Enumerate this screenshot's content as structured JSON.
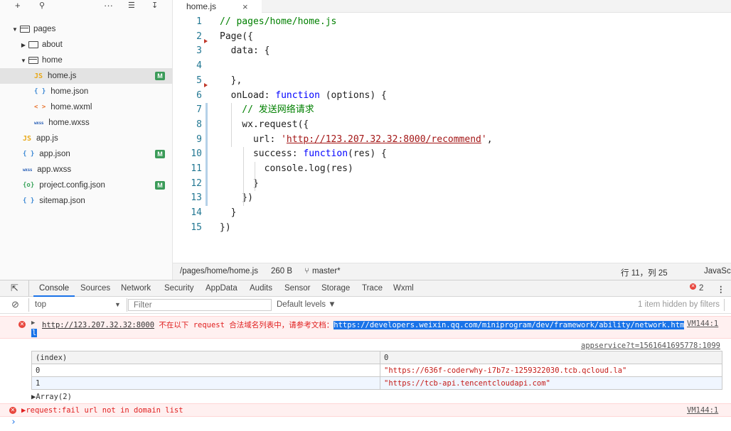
{
  "sidebar": {
    "toolbar": {
      "add": "+",
      "search": "🔍",
      "more": "···",
      "collapse": "☰",
      "split": "⊟"
    },
    "tree": [
      {
        "label": "pages",
        "type": "folder-open",
        "depth": 0
      },
      {
        "label": "about",
        "type": "folder-closed",
        "depth": 1
      },
      {
        "label": "home",
        "type": "folder-open",
        "depth": 1
      },
      {
        "label": "home.js",
        "type": "js",
        "depth": 2,
        "badge": "M",
        "selected": true
      },
      {
        "label": "home.json",
        "type": "json",
        "depth": 2
      },
      {
        "label": "home.wxml",
        "type": "wxml",
        "depth": 2
      },
      {
        "label": "home.wxss",
        "type": "wxss",
        "depth": 2
      },
      {
        "label": "app.js",
        "type": "js",
        "depth": 0
      },
      {
        "label": "app.json",
        "type": "json",
        "depth": 0,
        "badge": "M"
      },
      {
        "label": "app.wxss",
        "type": "wxss",
        "depth": 0
      },
      {
        "label": "project.config.json",
        "type": "cfg",
        "depth": 0,
        "badge": "M"
      },
      {
        "label": "sitemap.json",
        "type": "json",
        "depth": 0
      }
    ],
    "icons": {
      "js": "JS",
      "json": "{ }",
      "wxml": "< >",
      "wxss": "wxss",
      "cfg": "{o}"
    }
  },
  "editor": {
    "tab": {
      "label": "home.js",
      "close": "×"
    },
    "lines": [
      {
        "n": "1",
        "tokens": [
          [
            "c",
            "// pages/home/home.js"
          ]
        ]
      },
      {
        "n": "2",
        "tokens": [
          [
            "p",
            "Page({"
          ]
        ]
      },
      {
        "n": "3",
        "tokens": [
          [
            "p",
            "  data: {"
          ]
        ]
      },
      {
        "n": "4",
        "tokens": []
      },
      {
        "n": "5",
        "tokens": [
          [
            "p",
            "  },"
          ]
        ]
      },
      {
        "n": "6",
        "tokens": [
          [
            "p",
            "  onLoad: "
          ],
          [
            "k",
            "function"
          ],
          [
            "p",
            " (options) {"
          ]
        ]
      },
      {
        "n": "7",
        "tokens": [
          [
            "c",
            "    // 发送网络请求"
          ]
        ]
      },
      {
        "n": "8",
        "tokens": [
          [
            "p",
            "    wx.request({"
          ]
        ]
      },
      {
        "n": "9",
        "tokens": [
          [
            "p",
            "      url: "
          ],
          [
            "s",
            "'"
          ],
          [
            "u",
            "http://123.207.32.32:8000/recommend"
          ],
          [
            "s",
            "'"
          ],
          [
            "p",
            ","
          ]
        ]
      },
      {
        "n": "10",
        "tokens": [
          [
            "p",
            "      success: "
          ],
          [
            "k",
            "function"
          ],
          [
            "p",
            "(res) {"
          ]
        ]
      },
      {
        "n": "11",
        "tokens": [
          [
            "p",
            "        console.log(res)"
          ]
        ]
      },
      {
        "n": "12",
        "tokens": [
          [
            "p",
            "      }"
          ]
        ]
      },
      {
        "n": "13",
        "tokens": [
          [
            "p",
            "    })"
          ]
        ]
      },
      {
        "n": "14",
        "tokens": [
          [
            "p",
            "  }"
          ]
        ]
      },
      {
        "n": "15",
        "tokens": [
          [
            "p",
            "})"
          ]
        ]
      }
    ]
  },
  "statusbar": {
    "path": "/pages/home/home.js",
    "size": "260 B",
    "branch_icon": "⑂",
    "branch": "master*",
    "cursor": "行 11，列 25",
    "language": "JavaScript"
  },
  "devtools": {
    "tabs": [
      "Console",
      "Sources",
      "Network",
      "Security",
      "AppData",
      "Audits",
      "Sensor",
      "Storage",
      "Trace",
      "Wxml"
    ],
    "active_tab": "Console",
    "error_count": "2",
    "context": "top",
    "filter_placeholder": "Filter",
    "levels": "Default levels ▼",
    "hidden_note": "1 item hidden by filters",
    "messages": {
      "err1_url": "http://123.207.32.32:8000",
      "err1_text": " 不在以下 request 合法域名列表中，请参考文档：",
      "err1_doc": "https://developers.weixin.qq.com/miniprogram/dev/framework/ability/network.htm",
      "err1_src": "VM144:1",
      "err1_src_wrap": "l",
      "table_src": "appservice?t=1561641695778:1099",
      "table_headers": [
        "(index)",
        "0"
      ],
      "table_rows": [
        [
          "0",
          "\"https://636f-coderwhy-i7b7z-1259322030.tcb.qcloud.la\""
        ],
        [
          "1",
          "\"https://tcb-api.tencentcloudapi.com\""
        ]
      ],
      "array_label": "▶Array(2)",
      "err2_text": "▶request:fail url not in domain list",
      "err2_src": "VM144:1",
      "prompt": "›"
    }
  }
}
